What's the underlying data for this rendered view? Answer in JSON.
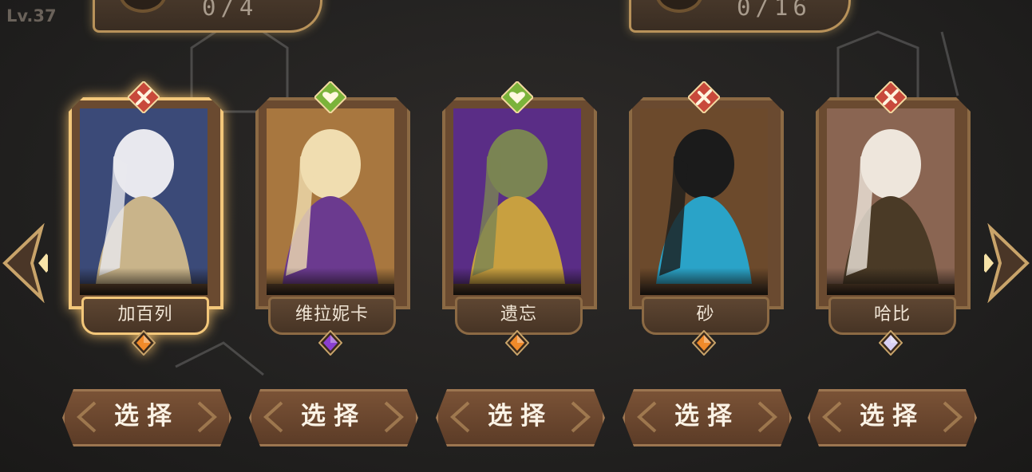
{
  "header": {
    "level": "Lv.37",
    "counter_left": "0/4",
    "counter_right": "0/16"
  },
  "heroes": [
    {
      "name": "加百列",
      "class_icon": "sword-icon",
      "class_color": "#c8493b",
      "gem": "orange-gem-icon",
      "gem_color": "#f08a2a",
      "selected": true
    },
    {
      "name": "维拉妮卡",
      "class_icon": "heart-icon",
      "class_color": "#7bb33a",
      "gem": "purple-gem-icon",
      "gem_color": "#8a3fd0",
      "selected": false
    },
    {
      "name": "遗忘",
      "class_icon": "heart-icon",
      "class_color": "#7bb33a",
      "gem": "orange-gem-icon",
      "gem_color": "#f08a2a",
      "selected": false
    },
    {
      "name": "砂",
      "class_icon": "sword-icon",
      "class_color": "#c8493b",
      "gem": "orange-gem-icon",
      "gem_color": "#f08a2a",
      "selected": false
    },
    {
      "name": "哈比",
      "class_icon": "sword-icon",
      "class_color": "#c8493b",
      "gem": "white-gem-icon",
      "gem_color": "#d8d0f4",
      "selected": false
    }
  ],
  "buttons": {
    "select_label": "选择"
  },
  "colors": {
    "frame": "#8c6a44",
    "selected_glow": "#f3c77a",
    "button": "#6a4530"
  }
}
